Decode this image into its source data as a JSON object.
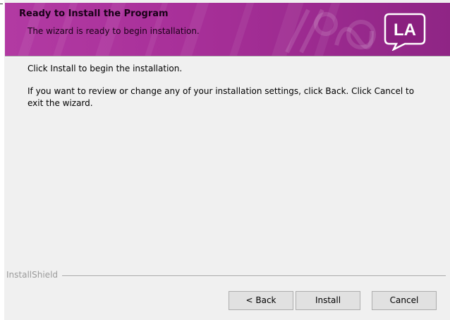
{
  "banner": {
    "title": "Ready to Install the Program",
    "subtitle": "The wizard is ready to begin installation.",
    "logo_text": "LA",
    "colors": {
      "accent": "#a83099",
      "logo": "#8a1f7f"
    }
  },
  "body": {
    "line1": "Click Install to begin the installation.",
    "line2": "If you want to review or change any of your installation settings, click Back. Click Cancel to exit the wizard."
  },
  "footer": {
    "brand": "InstallShield"
  },
  "buttons": {
    "back": "< Back",
    "install": "Install",
    "cancel": "Cancel"
  }
}
